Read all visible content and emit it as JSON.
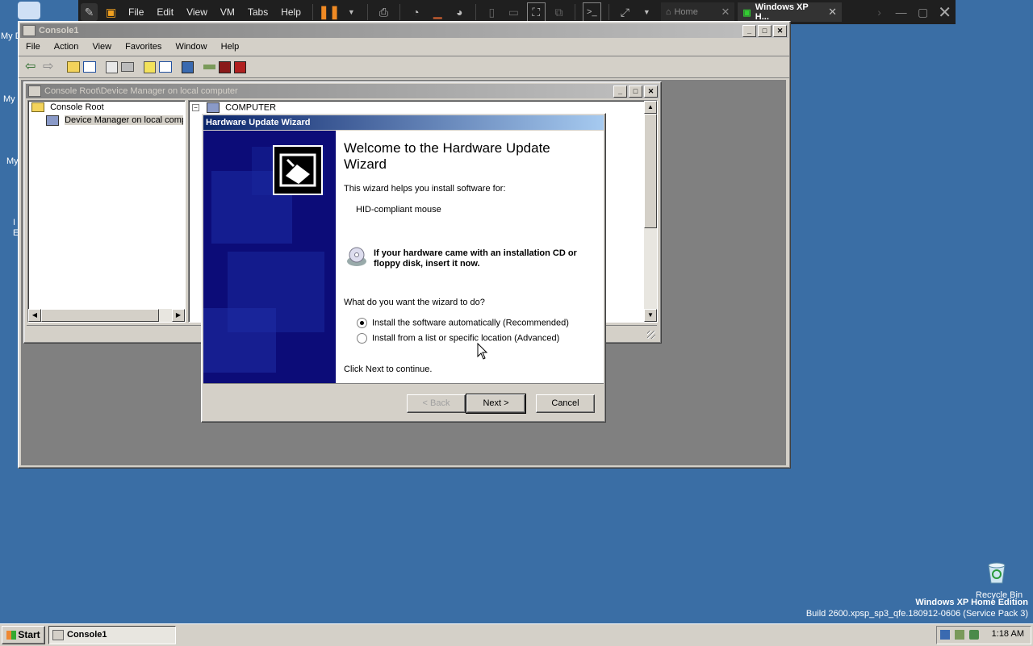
{
  "desktop": {
    "icon_labels": [
      "My D",
      "My",
      "My",
      "I",
      "E"
    ],
    "recycle_bin": "Recycle Bin",
    "watermark_line1": "Windows XP Home Edition",
    "watermark_line2": "Build 2600.xpsp_sp3_qfe.180912-0606 (Service Pack 3)"
  },
  "vm_toolbar": {
    "menus": [
      "File",
      "Edit",
      "View",
      "VM",
      "Tabs",
      "Help"
    ],
    "tabs": [
      {
        "label": "Home",
        "active": false
      },
      {
        "label": "Windows XP H...",
        "active": true
      }
    ]
  },
  "console": {
    "title": "Console1",
    "menus": [
      "File",
      "Action",
      "View",
      "Favorites",
      "Window",
      "Help"
    ],
    "child_title": "Console Root\\Device Manager on local computer",
    "tree": [
      "Console Root",
      "Device Manager on local compu"
    ],
    "device_root": "COMPUTER"
  },
  "wizard": {
    "title": "Hardware Update Wizard",
    "heading": "Welcome to the Hardware Update Wizard",
    "intro": "This wizard helps you install software for:",
    "device": "HID-compliant mouse",
    "cd_note": "If your hardware came with an installation CD or floppy disk, insert it now.",
    "question": "What do you want the wizard to do?",
    "options": [
      {
        "label": "Install the software automatically (Recommended)",
        "selected": true
      },
      {
        "label": "Install from a list or specific location (Advanced)",
        "selected": false
      }
    ],
    "continue": "Click Next to continue.",
    "back": "< Back",
    "next": "Next >",
    "cancel": "Cancel"
  },
  "taskbar": {
    "start": "Start",
    "task": "Console1",
    "clock": "1:18 AM"
  },
  "colors": {
    "desktop": "#3a6ea5",
    "title_active": "#0a246a",
    "wizard_side": "#0c0c78"
  }
}
